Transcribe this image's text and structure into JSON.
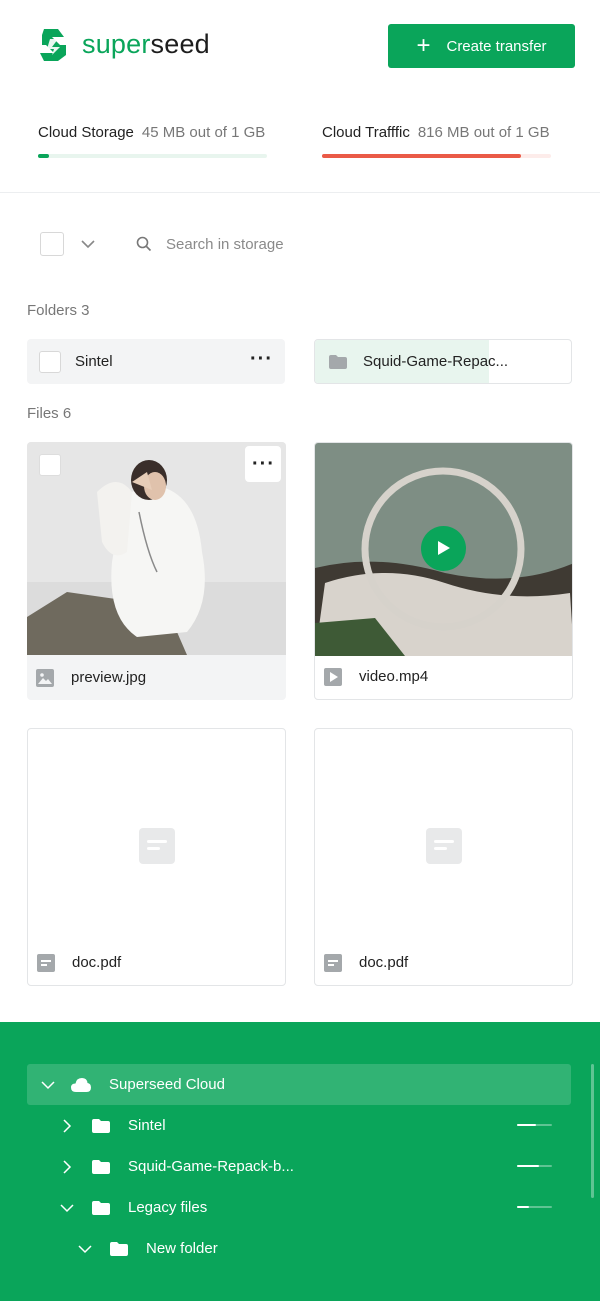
{
  "brand": {
    "name_a": "super",
    "name_b": "seed",
    "accent": "#0aa55a"
  },
  "header": {
    "create_label": "Create transfer"
  },
  "usage": {
    "storage": {
      "label": "Cloud Storage",
      "value": "45 MB out of 1 GB",
      "fill": 0.05,
      "color": "#0aa55a"
    },
    "traffic": {
      "label": "Cloud Trafffic",
      "value": "816 MB out of 1 GB",
      "fill": 0.87,
      "color": "#ea5a47"
    }
  },
  "toolbar": {
    "search_placeholder": "Search in storage"
  },
  "folders": {
    "title": "Folders 3",
    "items": [
      {
        "name": "Sintel"
      },
      {
        "name": "Squid-Game-Repac...",
        "upload_progress": 0.68
      }
    ]
  },
  "files": {
    "title": "Files 6",
    "items": [
      {
        "name": "preview.jpg",
        "type": "image-icon"
      },
      {
        "name": "video.mp4",
        "type": "play-icon"
      },
      {
        "name": "doc.pdf",
        "type": "document-icon"
      },
      {
        "name": "doc.pdf",
        "type": "document-icon"
      }
    ]
  },
  "tree": {
    "root": "Superseed Cloud",
    "items": [
      {
        "name": "Sintel",
        "usage": 0.55
      },
      {
        "name": "Squid-Game-Repack-b...",
        "usage": 0.62
      },
      {
        "name": "Legacy files",
        "usage": 0.35
      },
      {
        "name": "New folder"
      }
    ]
  }
}
